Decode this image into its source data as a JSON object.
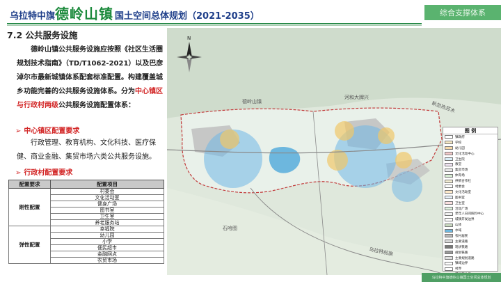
{
  "header": {
    "title_prefix": "乌拉特中旗",
    "title_town": "德岭山镇",
    "title_suffix": "国土空间总体规划（2021-2035）",
    "system_tab": "综合支撑体系"
  },
  "section": {
    "title": "7.2 公共服务设施"
  },
  "body": {
    "para1_a": "德岭山镇公共服务设施应按照《社区生活圈规划技术指南》（TD/T1062-2021）以及巴彦淖尔市最新城镇体系配套标准配置。构建覆盖城乡功能完善的公共服务设施体系。分为",
    "para1_highlight": "中心镇区与行政村两级",
    "para1_b": "公共服务设施配置体系：",
    "bullet1": "中心镇区配置要求",
    "para2": "行政管理、教育机构、文化科技、医疗保健、商业金融、集贸市场六类公共服务设施。",
    "bullet2": "行政村配置要求",
    "bullet_arrow": "➢"
  },
  "table": {
    "headers": [
      "配置要求",
      "配置项目"
    ],
    "groups": [
      {
        "name": "刚性配置",
        "items": [
          "村委会",
          "文化活动室",
          "健身广场",
          "图书室",
          "卫生室",
          "养老服务站"
        ]
      },
      {
        "name": "弹性配置",
        "items": [
          "幸福院",
          "幼儿园",
          "小学",
          "便民超市",
          "金融网点",
          "农贸市场"
        ]
      }
    ]
  },
  "map": {
    "labels": {
      "north_town": "德岭山镇",
      "area_right": "新忽热苏木",
      "area_mid": "河和大牌兴",
      "road_bottom": "乌拉特前旗",
      "mid_lower": "石哈图"
    },
    "legend": {
      "title": "图  例",
      "items": [
        {
          "label": "镇政府",
          "color": "#ffffff"
        },
        {
          "label": "学校",
          "color": "#f4e7c3"
        },
        {
          "label": "幼儿园",
          "color": "#f6d9a8"
        },
        {
          "label": "文化活动中心",
          "color": "#f3c9c9"
        },
        {
          "label": "卫生院",
          "color": "#d9eef7"
        },
        {
          "label": "教堂",
          "color": "#efe3f2"
        },
        {
          "label": "集贸市场",
          "color": "#e8e8e8"
        },
        {
          "label": "体育场",
          "color": "#d6ecd2"
        },
        {
          "label": "供销合作社",
          "color": "#f2ecd2"
        },
        {
          "label": "村委会",
          "color": "#ffffff"
        },
        {
          "label": "文化活动室",
          "color": "#fde8c8"
        },
        {
          "label": "图书室",
          "color": "#e7f0fa"
        },
        {
          "label": "卫生室",
          "color": "#fbe0e0"
        },
        {
          "label": "活动广场",
          "color": "#dff2df"
        },
        {
          "label": "老年人日间照料中心",
          "color": "#f1f1f1"
        },
        {
          "label": "城镇开发边界",
          "color": "#ffffff"
        },
        {
          "label": "山体",
          "color": "#c9d9c0"
        },
        {
          "label": "水域",
          "color": "#6db7de"
        },
        {
          "label": "农村居民",
          "color": "#b7b7b7"
        },
        {
          "label": "主要道路",
          "color": "#d9d9d9"
        },
        {
          "label": "现状铁路",
          "color": "#777777"
        },
        {
          "label": "规划铁路",
          "color": "#999999"
        },
        {
          "label": "主要规划道路",
          "color": "#e0e0e0"
        },
        {
          "label": "镇域边界",
          "color": "#ffffff"
        },
        {
          "label": "村界",
          "color": "#ffffff"
        },
        {
          "label": "其他镇边界",
          "color": "#ffffff"
        }
      ]
    }
  },
  "footer": {
    "text": "乌拉特中旗德岭山镇国土空间总体规划"
  },
  "colors": {
    "brand_green": "#1c8a3c",
    "title_blue": "#1f3f8a",
    "highlight_red": "#d22424",
    "tab_green": "#5ab36f"
  }
}
